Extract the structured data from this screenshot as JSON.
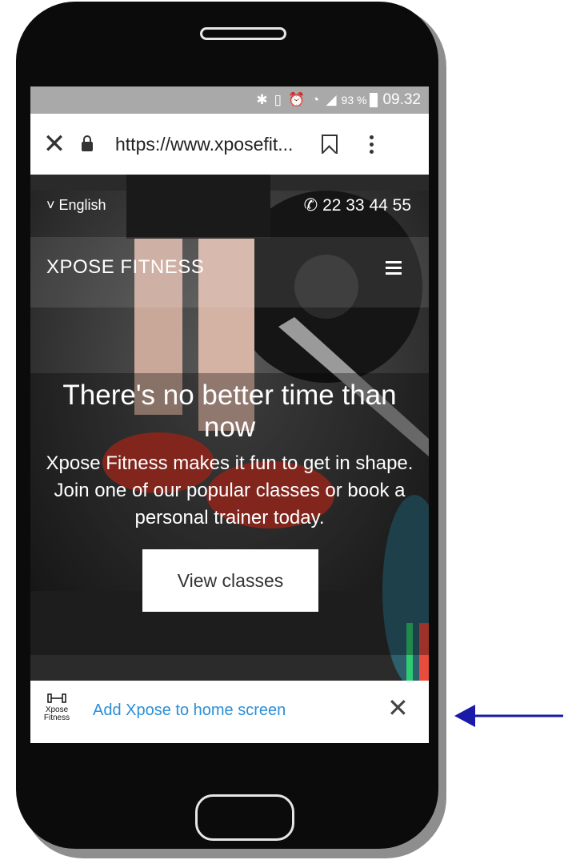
{
  "status_bar": {
    "icons": [
      "bluetooth-icon",
      "vibrate-icon",
      "alarm-icon",
      "wifi-icon",
      "signal-icon"
    ],
    "battery_percent": "93 %",
    "time": "09.32"
  },
  "browser": {
    "url": "https://www.xposefit...",
    "close_glyph": "✕"
  },
  "site": {
    "language": "English",
    "language_prefix": "˅",
    "phone_glyph": "✆",
    "phone": "22 33 44 55",
    "brand": "XPOSE FITNESS",
    "headline": "There's no better time than now",
    "subtext": "Xpose Fitness makes it fun to get in shape. Join one of our popular classes or book a personal trainer today.",
    "cta": "View classes"
  },
  "add_to_home": {
    "logo_line1": "Xpose",
    "logo_line2": "Fitness",
    "label": "Add Xpose to home screen",
    "close_glyph": "✕"
  },
  "colors": {
    "link_blue": "#2a8fd6",
    "arrow_blue": "#1a1aa8"
  }
}
